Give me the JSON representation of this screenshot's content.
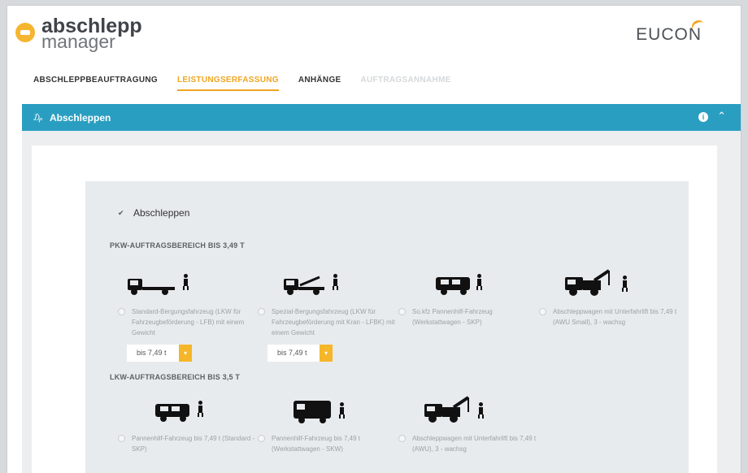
{
  "logo": {
    "line1": "abschlepp",
    "line2": "manager"
  },
  "brand": {
    "name": "EUCON"
  },
  "tabs": [
    {
      "label": "ABSCHLEPPBEAUFTRAGUNG",
      "state": "normal"
    },
    {
      "label": "LEISTUNGSERFASSUNG",
      "state": "active"
    },
    {
      "label": "ANHÄNGE",
      "state": "normal"
    },
    {
      "label": "AUFTRAGSANNAHME",
      "state": "disabled"
    }
  ],
  "section": {
    "title": "Abschleppen",
    "pin_icon": "pin-icon",
    "info_icon": "info-icon",
    "collapse_icon": "chevron-up-icon"
  },
  "main_checkbox": {
    "label": "Abschleppen",
    "checked": true
  },
  "pkw": {
    "title": "PKW-AUFTRAGSBEREICH BIS 3,49 T",
    "options": [
      {
        "label": "Standard-Bergungsfahrzeug (LKW für Fahrzeugbeförderung - LFB) mit einem Gewicht",
        "dropdown": "bis 7,49 t",
        "icon": "flatbed-truck-icon"
      },
      {
        "label": "Spezial-Bergungsfahrzeug (LKW für Fahrzeugbeförderung mit Kran - LFBK) mit einem Gewicht",
        "dropdown": "bis 7,49 t",
        "icon": "crane-flatbed-truck-icon"
      },
      {
        "label": "So.kfz Pannenhilf-Fahrzeug (Werkstattwagen - SKP)",
        "icon": "service-car-icon"
      },
      {
        "label": "Abschleppwagen mit Unterfahrlift bis 7,49 t (AWU Small), 3 - wachsg",
        "icon": "tow-truck-icon"
      }
    ]
  },
  "lkw": {
    "title": "LKW-AUFTRAGSBEREICH BIS 3,5 T",
    "options": [
      {
        "label": "Pannenhilf-Fahrzeug bis 7,49 t (Standard -SKP)",
        "icon": "service-car-icon"
      },
      {
        "label": "Pannenhilf-Fahrzeug bis 7,49 t (Werkstattwagen - SKW)",
        "icon": "workshop-van-icon"
      },
      {
        "label": "Abschleppwagen mit Unterfahrlift bis 7,49 t (AWU), 3 - wachsg",
        "icon": "tow-truck-icon"
      }
    ]
  },
  "colors": {
    "accent": "#f0a521",
    "section_bar": "#2a9ec1",
    "button": "#f5b62a"
  }
}
